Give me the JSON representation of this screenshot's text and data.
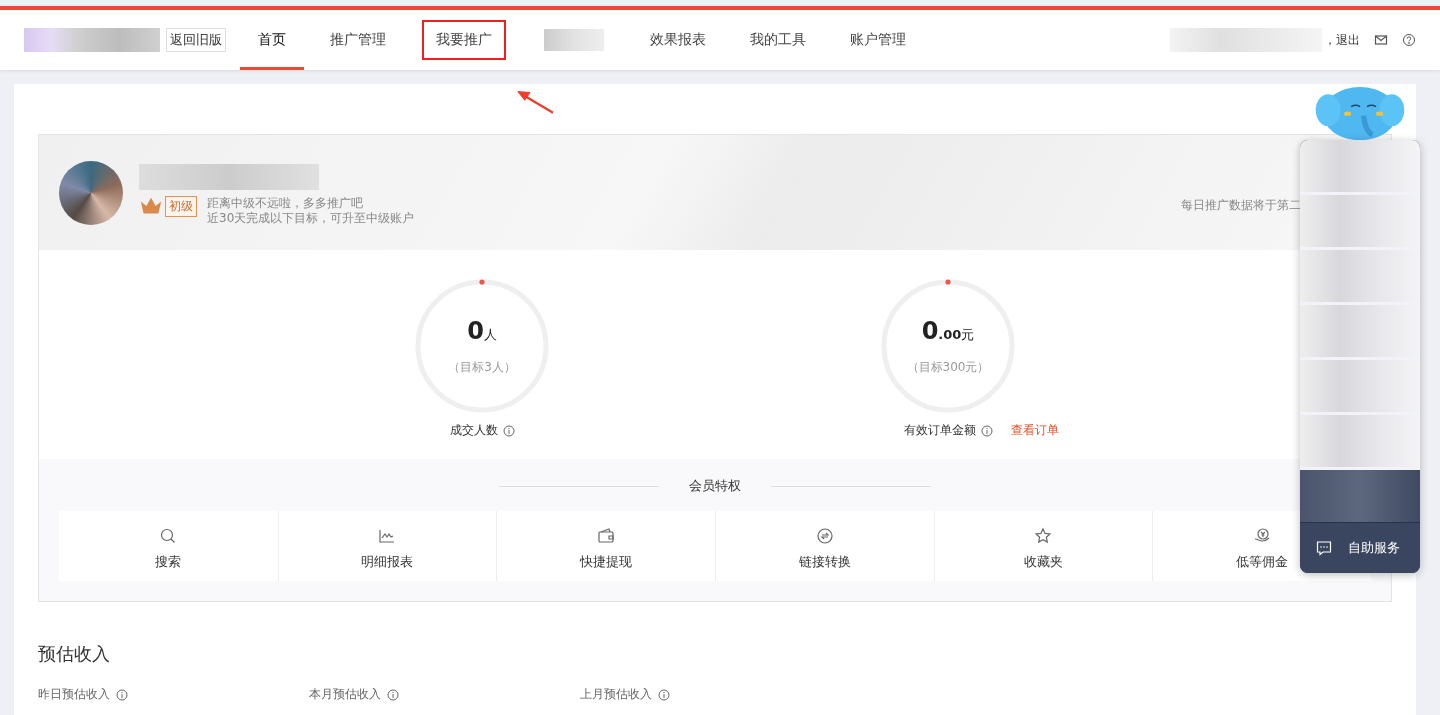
{
  "nav": {
    "back_button": "返回旧版",
    "items": [
      {
        "label": "首页",
        "selected": true,
        "redacted": false
      },
      {
        "label": "推广管理",
        "selected": false,
        "redacted": false
      },
      {
        "label": "我要推广",
        "selected": false,
        "redacted": false,
        "highlighted": true
      },
      {
        "selected": false,
        "redacted": true
      },
      {
        "label": "效果报表",
        "selected": false,
        "redacted": false
      },
      {
        "label": "我的工具",
        "selected": false,
        "redacted": false
      },
      {
        "label": "账户管理",
        "selected": false,
        "redacted": false
      }
    ],
    "logout": "，退出"
  },
  "profile": {
    "level_badge": "初级",
    "message": "距离中级不远啦，多多推广吧",
    "goal_text": "近30天完成以下目标，可升至中级账户",
    "notice": "每日推广数据将于第二"
  },
  "goals": [
    {
      "value": "0",
      "unit": "人",
      "target": "（目标3人）",
      "label": "成交人数"
    },
    {
      "value": "0",
      "fraction": ".00",
      "unit": "元",
      "target": "（目标300元）",
      "label": "有效订单金额",
      "link": "查看订单"
    }
  ],
  "privileges": {
    "title": "会员特权",
    "items": [
      "搜索",
      "明细报表",
      "快捷提现",
      "链接转换",
      "收藏夹",
      "低等佣金"
    ]
  },
  "income": {
    "title": "预估收入",
    "columns": [
      "昨日预估收入",
      "本月预估收入",
      "上月预估收入"
    ]
  },
  "side_panel": {
    "button": "自助服务"
  }
}
